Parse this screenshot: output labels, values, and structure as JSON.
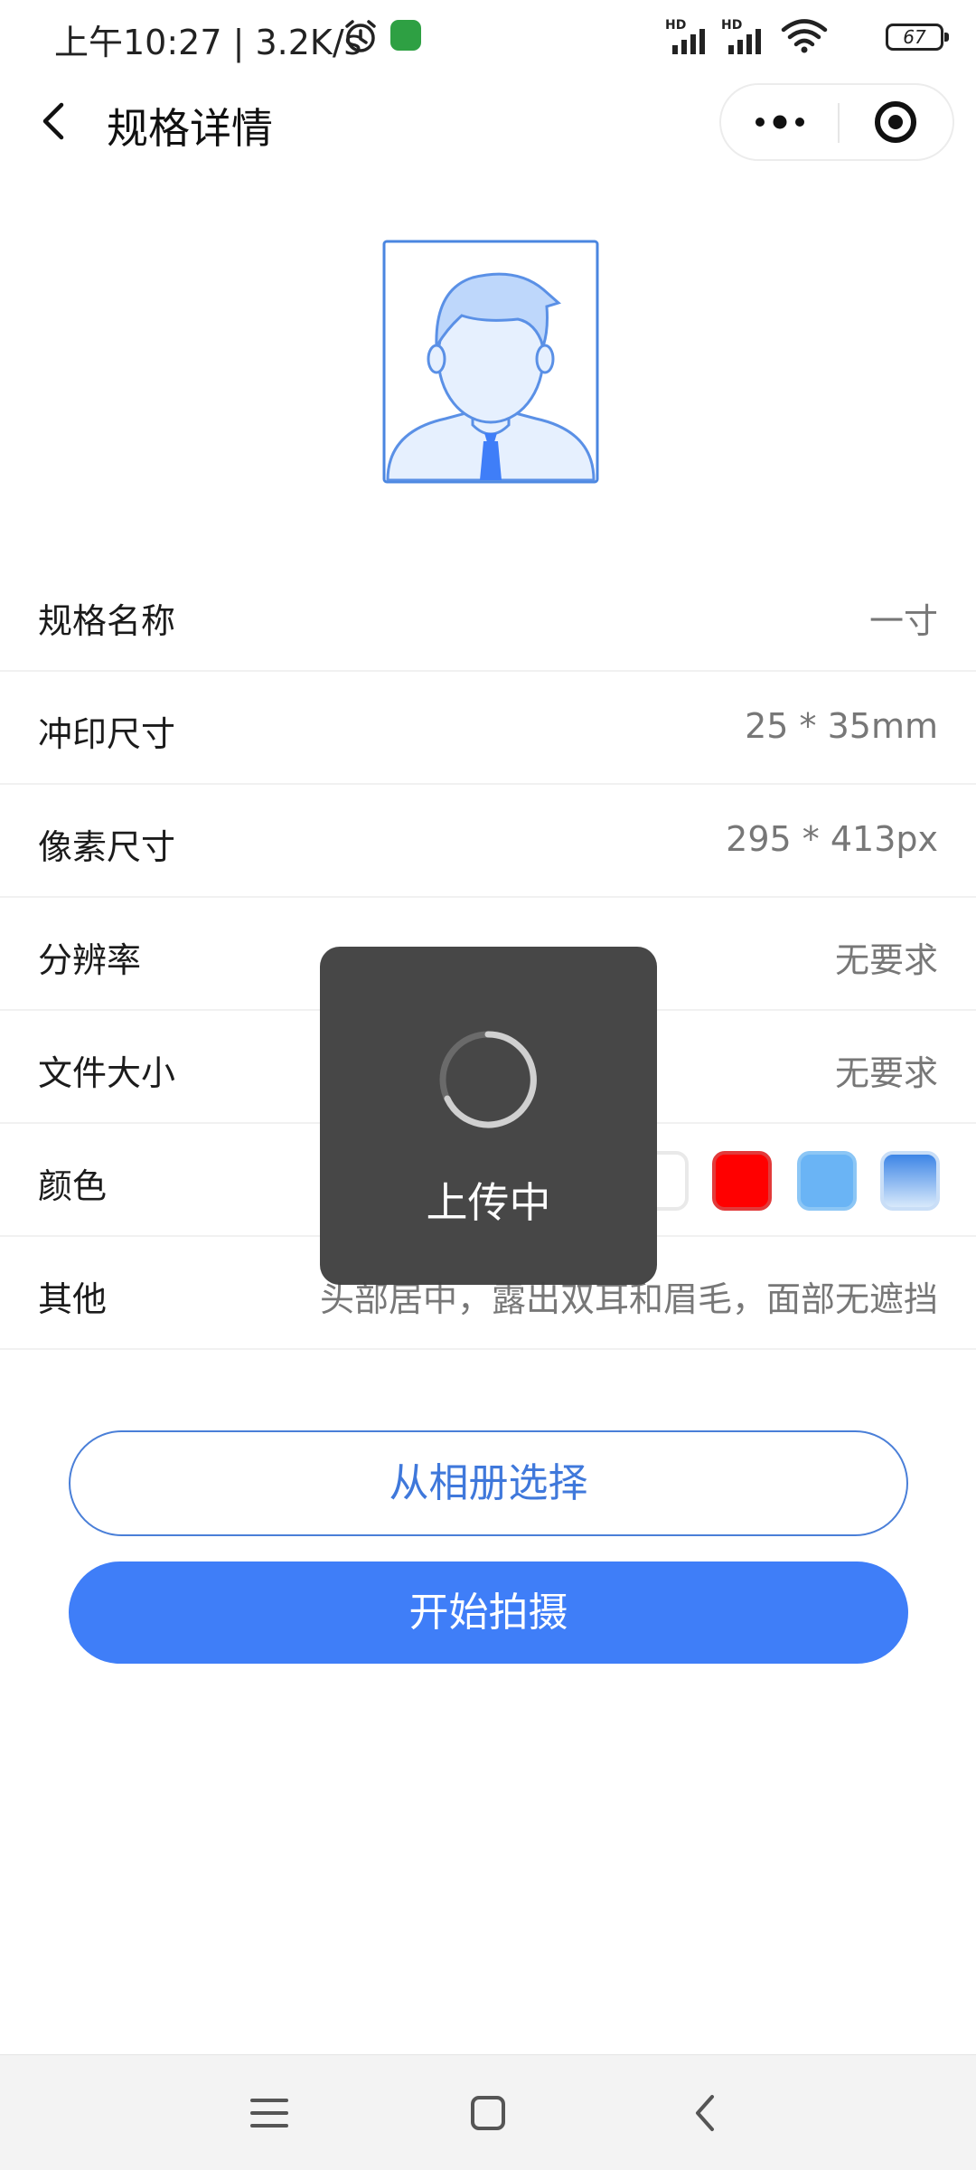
{
  "status_bar": {
    "time": "上午10:27 | 3.2K/s",
    "hd1": "HD",
    "hd2": "HD",
    "battery": "67"
  },
  "nav": {
    "title": "规格详情",
    "icons": [
      "back-icon",
      "more-icon",
      "target-close-icon"
    ]
  },
  "specs": [
    {
      "label": "规格名称",
      "value": "一寸"
    },
    {
      "label": "冲印尺寸",
      "value": "25 * 35mm"
    },
    {
      "label": "像素尺寸",
      "value": "295 * 413px"
    },
    {
      "label": "分辨率",
      "value": "无要求"
    },
    {
      "label": "文件大小",
      "value": "无要求"
    },
    {
      "label": "颜色",
      "value": ""
    },
    {
      "label": "其他",
      "value": "头部居中，露出双耳和眉毛，面部无遮挡"
    }
  ],
  "colors": [
    {
      "name": "white",
      "fill": "#ffffff",
      "border": "#e9e9e9"
    },
    {
      "name": "red",
      "fill": "#ff0000",
      "border": "#e23a3a"
    },
    {
      "name": "blue",
      "fill": "#6ab4f5",
      "border": "#8cc6f5"
    },
    {
      "name": "gradient-blue",
      "fill": "linear-gradient(#3d85e6,#d8e9fb)",
      "border": "#c9def7"
    }
  ],
  "buttons": {
    "album": "从相册选择",
    "shoot": "开始拍摄"
  },
  "toast": {
    "text": "上传中"
  },
  "accent": "#3f7ef8"
}
